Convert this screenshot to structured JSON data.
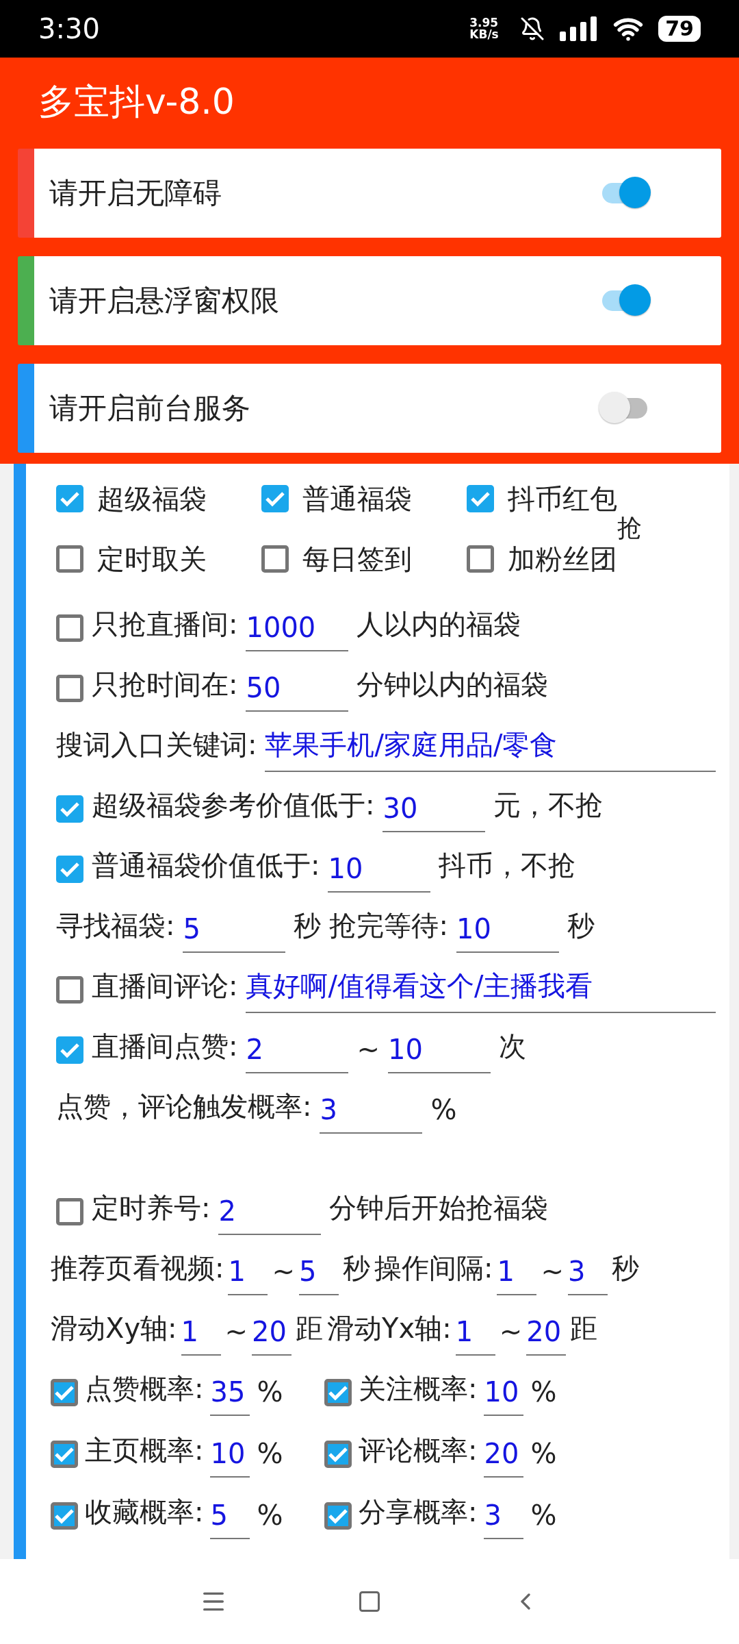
{
  "status_bar": {
    "time": "3:30",
    "net_speed": "3.95 KB/s",
    "battery": "79"
  },
  "app_title": "多宝抖v-8.0",
  "permissions": [
    {
      "label": "请开启无障碍",
      "on": true,
      "color": "#f44336"
    },
    {
      "label": "请开启悬浮窗权限",
      "on": true,
      "color": "#4caf50"
    },
    {
      "label": "请开启前台服务",
      "on": false,
      "color": "#2196f3"
    }
  ],
  "options": [
    {
      "label": "超级福袋",
      "checked": true
    },
    {
      "label": "普通福袋",
      "checked": true
    },
    {
      "label": "抖币红包",
      "checked": true,
      "overflow": "抢"
    },
    {
      "label": "定时取关",
      "checked": false
    },
    {
      "label": "每日签到",
      "checked": false
    },
    {
      "label": "加粉丝团",
      "checked": false
    }
  ],
  "settings": [
    {
      "kind": "row",
      "parts": [
        {
          "kind": "checkbox",
          "checked": false
        },
        {
          "kind": "text",
          "text": "只抢直播间:"
        },
        {
          "kind": "field",
          "value": "1000"
        },
        {
          "kind": "text",
          "text": "人以内的福袋"
        }
      ]
    },
    {
      "kind": "row",
      "parts": [
        {
          "kind": "checkbox",
          "checked": false
        },
        {
          "kind": "text",
          "text": "只抢时间在:"
        },
        {
          "kind": "field",
          "value": "50"
        },
        {
          "kind": "text",
          "text": "分钟以内的福袋"
        }
      ]
    },
    {
      "kind": "row",
      "parts": [
        {
          "kind": "text",
          "text": "搜词入口关键词:"
        },
        {
          "kind": "wide",
          "value": "苹果手机/家庭用品/零食"
        }
      ]
    },
    {
      "kind": "row",
      "parts": [
        {
          "kind": "checkbox",
          "checked": true
        },
        {
          "kind": "text",
          "text": "超级福袋参考价值低于:"
        },
        {
          "kind": "field",
          "value": "30"
        },
        {
          "kind": "text",
          "text": "元，不抢"
        }
      ]
    },
    {
      "kind": "row",
      "parts": [
        {
          "kind": "checkbox",
          "checked": true
        },
        {
          "kind": "text",
          "text": "普通福袋价值低于:"
        },
        {
          "kind": "field",
          "value": "10"
        },
        {
          "kind": "text",
          "text": "抖币，不抢"
        }
      ]
    },
    {
      "kind": "row",
      "parts": [
        {
          "kind": "text",
          "text": "寻找福袋:"
        },
        {
          "kind": "field",
          "value": "5"
        },
        {
          "kind": "text",
          "text": "秒"
        },
        {
          "kind": "text",
          "text": "抢完等待:"
        },
        {
          "kind": "field",
          "value": "10"
        },
        {
          "kind": "text",
          "text": "秒"
        }
      ]
    },
    {
      "kind": "row",
      "parts": [
        {
          "kind": "checkbox",
          "checked": false
        },
        {
          "kind": "text",
          "text": "直播间评论:"
        },
        {
          "kind": "wide",
          "value": "真好啊/值得看这个/主播我看"
        }
      ]
    },
    {
      "kind": "row",
      "parts": [
        {
          "kind": "checkbox",
          "checked": true
        },
        {
          "kind": "text",
          "text": "直播间点赞:"
        },
        {
          "kind": "field",
          "value": "2"
        },
        {
          "kind": "text",
          "text": "~"
        },
        {
          "kind": "field",
          "value": "10"
        },
        {
          "kind": "text",
          "text": "次"
        }
      ]
    },
    {
      "kind": "row",
      "parts": [
        {
          "kind": "text",
          "text": "点赞，评论触发概率:"
        },
        {
          "kind": "field",
          "value": "3"
        },
        {
          "kind": "text",
          "text": "%"
        }
      ]
    },
    {
      "kind": "spacer"
    },
    {
      "kind": "row",
      "parts": [
        {
          "kind": "checkbox",
          "checked": false
        },
        {
          "kind": "text",
          "text": "定时养号:"
        },
        {
          "kind": "field",
          "value": "2"
        },
        {
          "kind": "text",
          "text": "分钟后开始抢福袋"
        }
      ]
    },
    {
      "kind": "tight",
      "parts": [
        {
          "kind": "text",
          "text": "推荐页看视频:"
        },
        {
          "kind": "narrow",
          "value": "1"
        },
        {
          "kind": "text",
          "text": "~"
        },
        {
          "kind": "narrow",
          "value": "5"
        },
        {
          "kind": "text",
          "text": "秒"
        },
        {
          "kind": "text",
          "text": "操作间隔:"
        },
        {
          "kind": "narrow",
          "value": "1"
        },
        {
          "kind": "text",
          "text": "~"
        },
        {
          "kind": "narrow",
          "value": "3"
        },
        {
          "kind": "text",
          "text": "秒"
        }
      ]
    },
    {
      "kind": "tight",
      "parts": [
        {
          "kind": "text",
          "text": "滑动Xy轴:"
        },
        {
          "kind": "narrow",
          "value": "1"
        },
        {
          "kind": "text",
          "text": "~"
        },
        {
          "kind": "narrow",
          "value": "20"
        },
        {
          "kind": "text",
          "text": "距"
        },
        {
          "kind": "text",
          "text": "滑动Yx轴:"
        },
        {
          "kind": "narrow",
          "value": "1"
        },
        {
          "kind": "text",
          "text": "~"
        },
        {
          "kind": "narrow",
          "value": "20"
        },
        {
          "kind": "text",
          "text": "距"
        }
      ]
    }
  ],
  "probabilities": [
    {
      "label": "点赞概率:",
      "checked": true,
      "value": "35",
      "unit": "%"
    },
    {
      "label": "关注概率:",
      "checked": true,
      "value": "10",
      "unit": "%"
    },
    {
      "label": "主页概率:",
      "checked": true,
      "value": "10",
      "unit": "%"
    },
    {
      "label": "评论概率:",
      "checked": true,
      "value": "20",
      "unit": "%"
    },
    {
      "label": "收藏概率:",
      "checked": true,
      "value": "5",
      "unit": "%"
    },
    {
      "label": "分享概率:",
      "checked": true,
      "value": "3",
      "unit": "%"
    }
  ]
}
